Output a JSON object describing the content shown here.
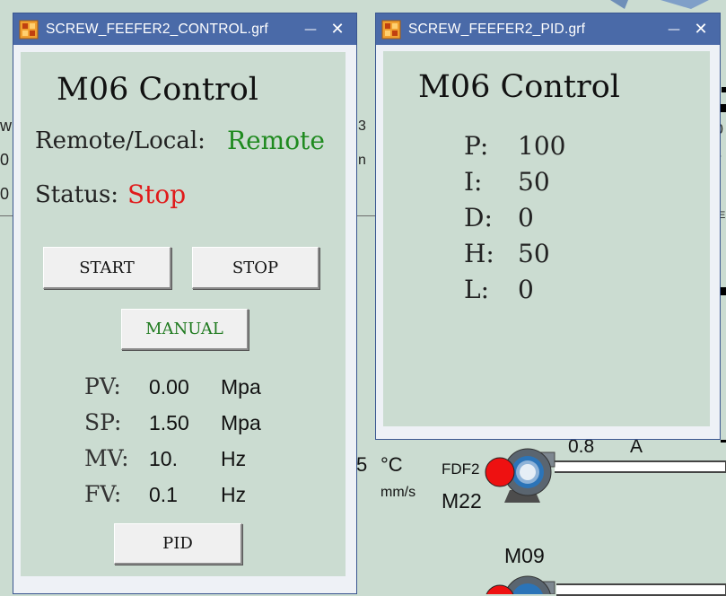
{
  "background": {
    "left_frags": [
      "w",
      "0",
      "0"
    ],
    "mid_frags": [
      "3",
      "n"
    ],
    "right_frags": [
      "0",
      "/",
      "E"
    ],
    "temp_value": "5",
    "temp_unit": "°C",
    "speed_unit": "mm/s",
    "fdf_label": "FDF2",
    "m22_label": "M22",
    "current_value": "0.8",
    "current_unit": "A",
    "m09_label": "M09"
  },
  "control_window": {
    "title": "SCREW_FEEFER2_CONTROL.grf",
    "heading": "M06 Control",
    "remote_local_label": "Remote/Local:",
    "remote_local_value": "Remote",
    "status_label": "Status:",
    "status_value": "Stop",
    "start_label": "START",
    "stop_label": "STOP",
    "manual_label": "MANUAL",
    "readings": [
      {
        "label": "PV:",
        "value": "0.00",
        "unit": "Mpa"
      },
      {
        "label": "SP:",
        "value": "1.50",
        "unit": "Mpa"
      },
      {
        "label": "MV:",
        "value": "10.",
        "unit": "Hz"
      },
      {
        "label": "FV:",
        "value": "0.1",
        "unit": "Hz"
      }
    ],
    "pid_label": "PID"
  },
  "pid_window": {
    "title": "SCREW_FEEFER2_PID.grf",
    "heading": "M06 Control",
    "params": [
      {
        "label": "P:",
        "value": "100"
      },
      {
        "label": "I:",
        "value": "50"
      },
      {
        "label": "D:",
        "value": "0"
      },
      {
        "label": "H:",
        "value": "50"
      },
      {
        "label": "L:",
        "value": "0"
      }
    ]
  },
  "colors": {
    "remote_green": "#1f8a1f",
    "status_red": "#e01b1b",
    "manual_green": "#1f7a1f",
    "titlebar": "#4a6aa8",
    "panel": "#cbdcd1"
  },
  "window_controls": {
    "minimize": "—",
    "close": "✕"
  }
}
